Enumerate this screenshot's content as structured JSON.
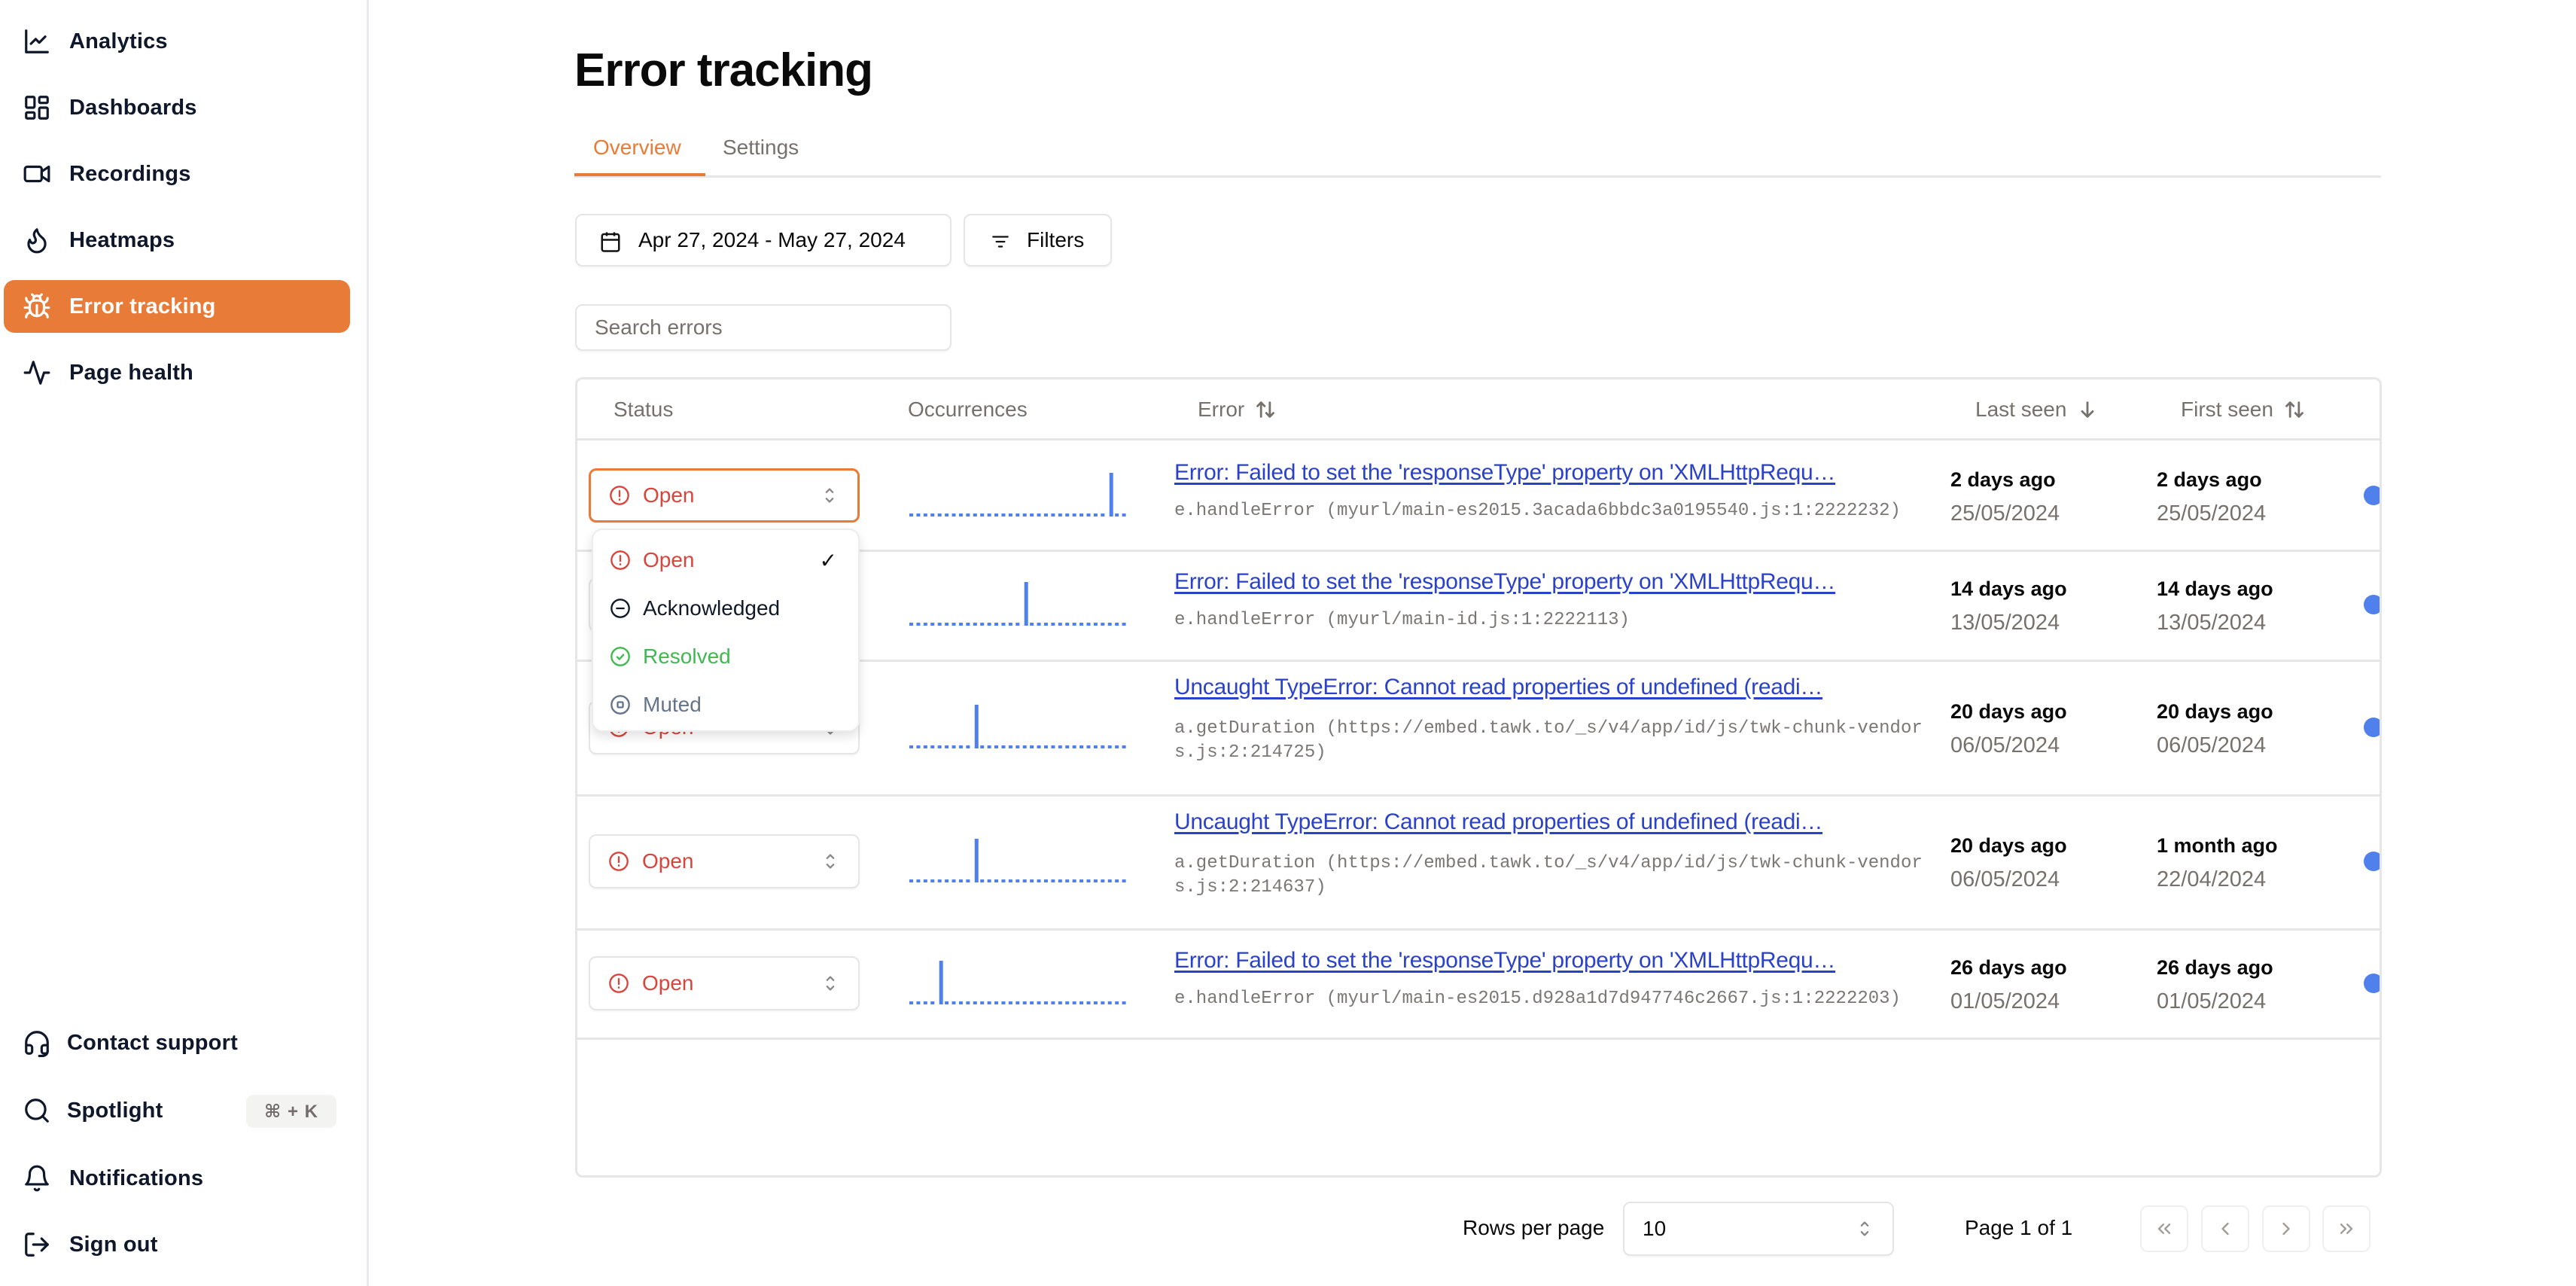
{
  "sidebar": {
    "top_items": [
      {
        "label": "Analytics",
        "icon": "chart-line-icon",
        "active": false
      },
      {
        "label": "Dashboards",
        "icon": "dashboard-grid-icon",
        "active": false
      },
      {
        "label": "Recordings",
        "icon": "video-camera-icon",
        "active": false
      },
      {
        "label": "Heatmaps",
        "icon": "flame-icon",
        "active": false
      },
      {
        "label": "Error tracking",
        "icon": "bug-icon",
        "active": true
      },
      {
        "label": "Page health",
        "icon": "activity-pulse-icon",
        "active": false
      }
    ],
    "bottom_items": [
      {
        "label": "Contact support",
        "icon": "headset-icon"
      },
      {
        "label": "Spotlight",
        "icon": "search-icon",
        "shortcut": "⌘ + K"
      },
      {
        "label": "Notifications",
        "icon": "bell-icon"
      },
      {
        "label": "Sign out",
        "icon": "sign-out-icon"
      }
    ]
  },
  "header": {
    "title": "Error tracking",
    "tabs": [
      {
        "label": "Overview",
        "active": true
      },
      {
        "label": "Settings",
        "active": false
      }
    ]
  },
  "toolbar": {
    "date_range": "Apr 27, 2024 - May 27, 2024",
    "filters_label": "Filters",
    "search_placeholder": "Search errors",
    "search_value": ""
  },
  "table": {
    "columns": {
      "status": "Status",
      "occurrences": "Occurrences",
      "error": "Error",
      "last_seen": "Last seen",
      "first_seen": "First seen"
    },
    "sort": {
      "error": "unsorted",
      "last_seen": "descending",
      "first_seen": "unsorted"
    },
    "rows": [
      {
        "status": "Open",
        "occurrence_bins": 31,
        "spike_bin": 28,
        "title": "Error: Failed to set the 'responseType' property on 'XMLHttpRequ…",
        "trace": "e.handleError (myurl/main-es2015.3acada6bbdc3a0195540.js:1:2222232)",
        "last_seen_relative": "2 days ago",
        "last_seen_date": "25/05/2024",
        "first_seen_relative": "2 days ago",
        "first_seen_date": "25/05/2024"
      },
      {
        "status": "Open",
        "occurrence_bins": 31,
        "spike_bin": 16,
        "title": "Error: Failed to set the 'responseType' property on 'XMLHttpRequ…",
        "trace": "e.handleError (myurl/main-id.js:1:2222113)",
        "last_seen_relative": "14 days ago",
        "last_seen_date": "13/05/2024",
        "first_seen_relative": "14 days ago",
        "first_seen_date": "13/05/2024"
      },
      {
        "status": "Open",
        "occurrence_bins": 31,
        "spike_bin": 9,
        "title": "Uncaught TypeError: Cannot read properties of undefined (readi…",
        "trace": "a.getDuration (https://embed.tawk.to/_s/v4/app/id/js/twk-chunk-vendors.js:2:214725)",
        "last_seen_relative": "20 days ago",
        "last_seen_date": "06/05/2024",
        "first_seen_relative": "20 days ago",
        "first_seen_date": "06/05/2024"
      },
      {
        "status": "Open",
        "occurrence_bins": 31,
        "spike_bin": 9,
        "title": "Uncaught TypeError: Cannot read properties of undefined (readi…",
        "trace": "a.getDuration (https://embed.tawk.to/_s/v4/app/id/js/twk-chunk-vendors.js:2:214637)",
        "last_seen_relative": "20 days ago",
        "last_seen_date": "06/05/2024",
        "first_seen_relative": "1 month ago",
        "first_seen_date": "22/04/2024"
      },
      {
        "status": "Open",
        "occurrence_bins": 31,
        "spike_bin": 4,
        "title": "Error: Failed to set the 'responseType' property on 'XMLHttpRequ…",
        "trace": "e.handleError (myurl/main-es2015.d928a1d7d947746c2667.js:1:2222203)",
        "last_seen_relative": "26 days ago",
        "last_seen_date": "01/05/2024",
        "first_seen_relative": "26 days ago",
        "first_seen_date": "01/05/2024"
      }
    ]
  },
  "status_dropdown": {
    "open_for_row": 0,
    "options": [
      {
        "label": "Open",
        "icon": "alert-circle-icon",
        "color": "#d9443c",
        "selected": true
      },
      {
        "label": "Acknowledged",
        "icon": "minus-circle-icon",
        "color": "#111827",
        "selected": false
      },
      {
        "label": "Resolved",
        "icon": "check-circle-icon",
        "color": "#3fb950",
        "selected": false
      },
      {
        "label": "Muted",
        "icon": "stop-circle-icon",
        "color": "#64748b",
        "selected": false
      }
    ],
    "check_mark": "✓"
  },
  "pagination": {
    "rows_per_page_label": "Rows per page",
    "rows_per_page_value": "10",
    "page_info": "Page 1 of 1"
  },
  "colors": {
    "accent": "#e87b38",
    "link": "#2a41c9",
    "status_open": "#d9443c",
    "sparkline": "#4f80ec"
  }
}
